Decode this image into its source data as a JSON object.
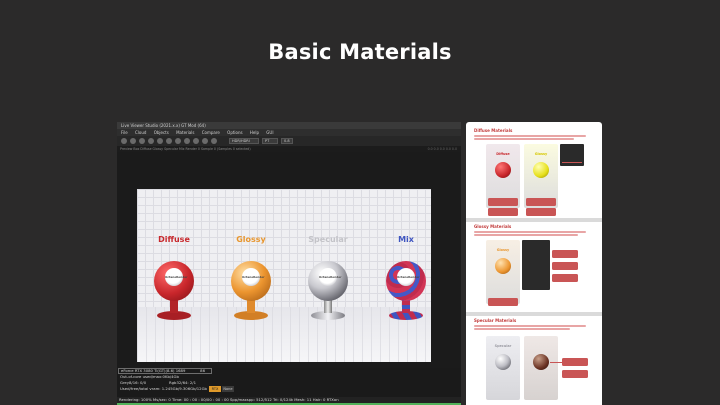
{
  "slide": {
    "title": "Basic Materials"
  },
  "window": {
    "title_text": "Live Viewer Studio (2021.x.x) GT Mod (64)",
    "menu": [
      "File",
      "Cloud",
      "Objects",
      "Materials",
      "Compare",
      "Options",
      "Help",
      "GUI"
    ],
    "toolbar_field_1": "HDR/HDRI",
    "toolbar_field_2": "PT",
    "toolbar_field_3": "0.8",
    "info_text": "Preview Box Diffuse Glossy Specular Mix Render 0 Sample 0 (Samples 0 selected)",
    "info_right": "0.0 0.0 0.0 0.0 0.0"
  },
  "render": {
    "materials": [
      {
        "label": "Diffuse",
        "label_color": "#c8282c",
        "sphere_color": "#c8262b",
        "eye_text": "OctaneRender"
      },
      {
        "label": "Glossy",
        "label_color": "#e8962e",
        "sphere_color": "#e38a2d",
        "eye_text": "OctaneRender"
      },
      {
        "label": "Specular",
        "label_color": "#c3c3c8",
        "sphere_color": "#bdbdc4",
        "eye_text": "OctaneRender"
      },
      {
        "label": "Mix",
        "label_color": "#3f55c0",
        "sphere_color": "#c02c4e",
        "eye_text": "OctaneRender"
      }
    ]
  },
  "status": {
    "gpu": "eForce RTX 3080 Ti(GT)(8.6) 1689",
    "gpu_value": "86",
    "outofcore": "Out-of-core used/max:0Kb/4Gb",
    "grey": "Grey8/16: 0/0",
    "rgb": "Rgb32/64: 2/1",
    "vram": "Used/free/total vram: 1.245Gb/9.306Gb/12Gb",
    "btn_orange": "RTX",
    "btn_grey": "None",
    "render_line": "Rendering: 100%  Ms/sec: 0    Time: 00 : 00 : 00/00 : 00 : 00    Spp/maxspp: 512/512    Tri: 0/124k    Mesh: 11    Hair: 0    RTXon",
    "progress": 1.0
  },
  "panel": {
    "sections": [
      {
        "title": "Diffuse Materials"
      },
      {
        "title": "Glossy Materials"
      },
      {
        "title": "Specular Materials"
      }
    ],
    "thumb_labels": [
      "Diffuse",
      "Glossy",
      "Glossy",
      "Specular"
    ]
  },
  "colors": {
    "background": "#2b2a2a",
    "accent": "#c23b3b",
    "progress": "#52b25a"
  }
}
